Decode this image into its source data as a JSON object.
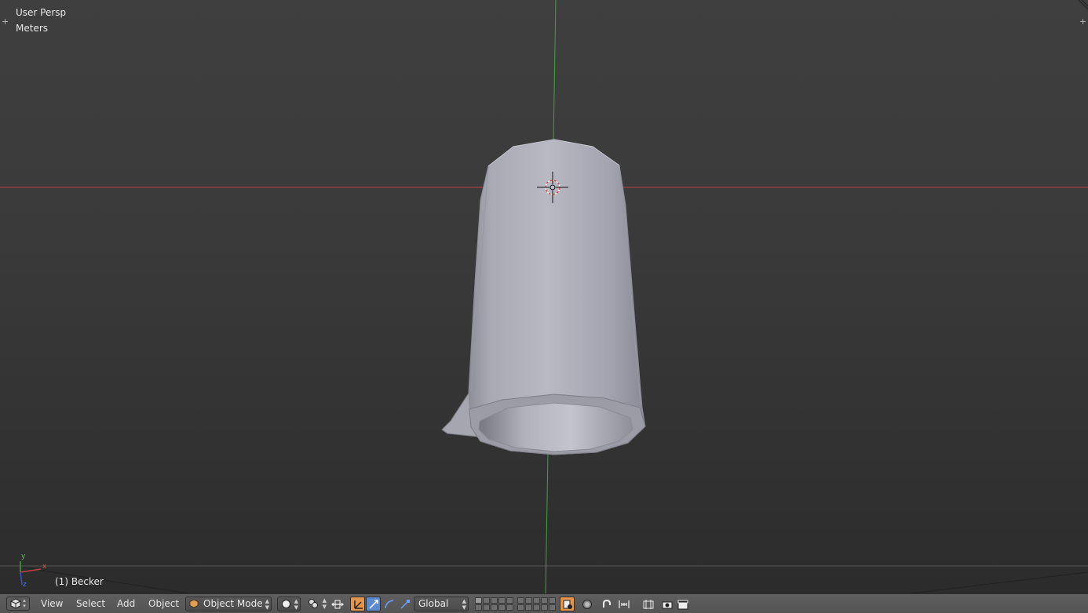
{
  "viewport": {
    "view_name": "User Persp",
    "units": "Meters",
    "active_object": "(1) Becker"
  },
  "axes": {
    "x_label": "x",
    "y_label": "y",
    "z_label": "z"
  },
  "header": {
    "menus": [
      "View",
      "Select",
      "Add",
      "Object"
    ],
    "mode": "Object Mode",
    "transform_orientation": "Global"
  },
  "colors": {
    "viewport_bg": "#393939",
    "x_axis": "#c43f3f",
    "y_axis": "#3fa33f",
    "mesh": "#b4b4be",
    "active_tool": "#e4954a",
    "header_bg": "#585858"
  },
  "icons": {
    "editor_type": "cube-icon",
    "mode": "object-mode-icon",
    "shading": "solid-sphere-icon",
    "pivot": "pivot-point-icon",
    "manipulator": "transform-manipulator-icon"
  }
}
